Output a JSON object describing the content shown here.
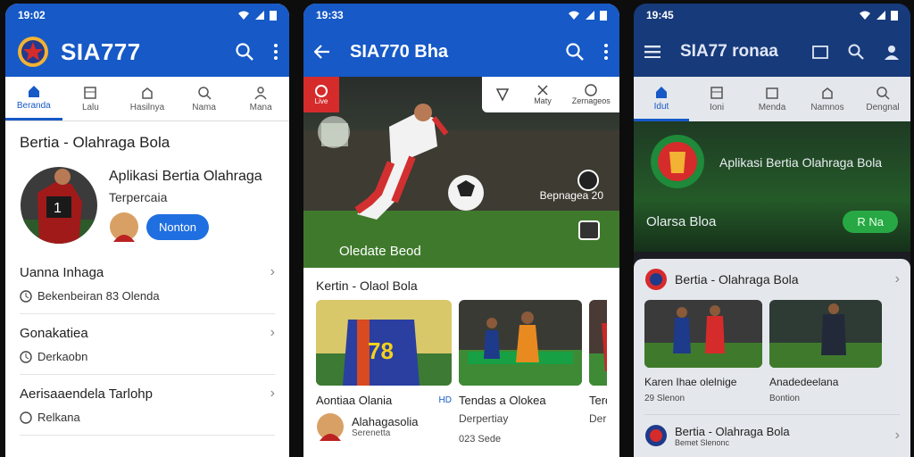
{
  "phone1": {
    "status_time": "19:02",
    "app_title": "SIA777",
    "tabs": [
      {
        "label": "Beranda"
      },
      {
        "label": "Lalu"
      },
      {
        "label": "Hasilnya"
      },
      {
        "label": "Nama"
      },
      {
        "label": "Mana"
      }
    ],
    "section_title": "Bertia - Olahraga Bola",
    "app_name": "Aplikasi Bertia Olahraga",
    "app_sub": "Terpercaia",
    "cta_label": "Nonton",
    "list": [
      {
        "title": "Uanna Inhaga",
        "sub": "Bekenbeiran 83 Olenda"
      },
      {
        "title": "Gonakatiea",
        "sub": "Derkaobn"
      },
      {
        "title": "Aerisaaendela Tarlohp",
        "sub": "Relkana"
      }
    ]
  },
  "phone2": {
    "status_time": "19:33",
    "app_title": "SIA770 Bha",
    "live_badge": "Live",
    "hero_caption": "Oledate Beod",
    "hero_side": "Bepnagea 20",
    "top_tabs": [
      {
        "label": ""
      },
      {
        "label": "Maty"
      },
      {
        "label": "Zernageos"
      }
    ],
    "section_title": "Kertin - Olaol Bola",
    "cards": [
      {
        "title": "Aontiaa Olania",
        "tag": "HD"
      },
      {
        "title": "Tendas a Olokea",
        "sub": "Derpertiay",
        "meta": "023 Sede"
      },
      {
        "title": "Terd",
        "sub": "Derpe"
      }
    ],
    "jersey_number": "78",
    "card1_channel": "Alahagasolia",
    "card1_meta": "Serenetta"
  },
  "phone3": {
    "status_time": "19:45",
    "app_title": "SIA77 ronaa",
    "tabs": [
      {
        "label": "Idut"
      },
      {
        "label": "Ioni"
      },
      {
        "label": "Menda"
      },
      {
        "label": "Namnos"
      },
      {
        "label": "Dengnal"
      }
    ],
    "banner_title": "Aplikasi Bertia Olahraga Bola",
    "banner_sub": "Olarsa Bloa",
    "banner_btn": "R Na",
    "group1_title": "Bertia - Olahraga Bola",
    "group1_items": [
      {
        "title": "Karen Ihae olelnige",
        "sub": "29 Slenon"
      },
      {
        "title": "Anadedeelana",
        "sub": "Bontion"
      }
    ],
    "group2_title": "Bertia - Olahraga Bola",
    "group2_sub": "Bemet Slenonc"
  },
  "colors": {
    "blue": "#1659c7",
    "green": "#27a844",
    "red": "#d62b2b"
  }
}
